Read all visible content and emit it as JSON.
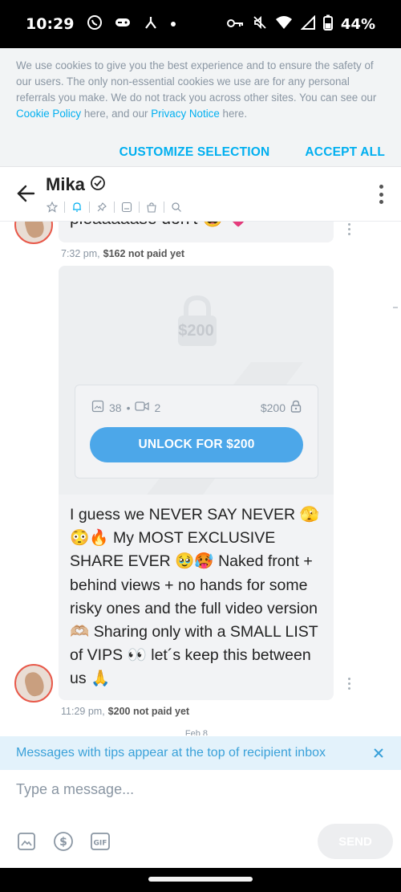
{
  "status_bar": {
    "time": "10:29",
    "battery": "44%"
  },
  "cookie_banner": {
    "text_before_link1": "We use cookies to give you the best experience and to ensure the safety of our users. The only non-essential cookies we use are for any personal referrals you make. We do not track you across other sites. You can see our ",
    "link1": "Cookie Policy",
    "text_between": " here, and our ",
    "link2": "Privacy Notice",
    "text_after": " here.",
    "customize_label": "CUSTOMIZE SELECTION",
    "accept_label": "ACCEPT ALL"
  },
  "header": {
    "name": "Mika"
  },
  "messages": {
    "prev_text_partial": "pleaaaaase don't 😅 💗",
    "msg1_time": "7:32 pm,",
    "msg1_price_status": "$162 not paid yet",
    "ppv_price_overlay": "$200",
    "ppv_photo_count": "38",
    "ppv_video_count": "2",
    "ppv_price": "$200",
    "unlock_label": "UNLOCK FOR $200",
    "ppv_text": "I guess we NEVER SAY NEVER 🫣😳🔥 My MOST EXCLUSIVE SHARE EVER 🥹🥵 Naked front + behind views + no hands for some risky ones and the full video version 🫶🏼 Sharing only with a SMALL LIST of VIPS 👀 let´s keep this between us 🙏",
    "msg2_time": "11:29 pm,",
    "msg2_price_status": "$200 not paid yet",
    "date_divider_partial": "Feb 8"
  },
  "tip_bar": {
    "text": "Messages with tips appear at the top of recipient inbox"
  },
  "composer": {
    "placeholder": "Type a message...",
    "send_label": "SEND",
    "gif_label": "GIF"
  },
  "colors": {
    "accent": "#00aff0",
    "unlock_button": "#4ca7e9",
    "avatar_ring": "#e8594a"
  }
}
